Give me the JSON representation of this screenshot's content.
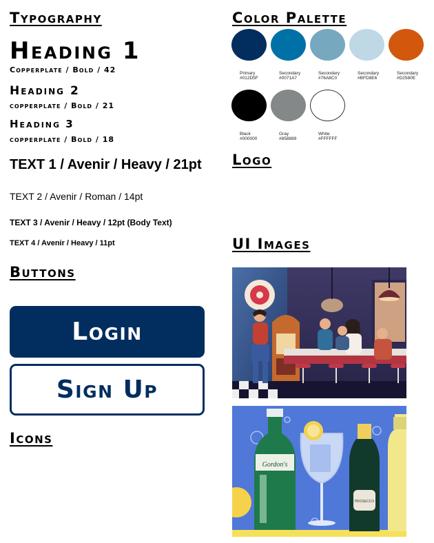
{
  "typography": {
    "title": "Typography",
    "heading1": {
      "text": "Heading 1",
      "spec": "Copperplate / Bold / 42"
    },
    "heading2": {
      "text": "Heading 2",
      "spec": "copperplate / Bold / 21"
    },
    "heading3": {
      "text": "Heading 3",
      "spec": "copperplate / Bold / 18"
    },
    "text1": "TEXT 1 / Avenir / Heavy / 21pt",
    "text2": "TEXT 2 / Avenir / Roman / 14pt",
    "text3": "TEXT 3 / Avenir / Heavy / 12pt (Body Text)",
    "text4": "TEXT 4 / Avenir / Heavy / 11pt"
  },
  "buttons": {
    "title": "Buttons",
    "login_label": "Login",
    "signup_label": "Sign Up"
  },
  "icons": {
    "title": "Icons"
  },
  "palette": {
    "title": "Color Palette",
    "row1": [
      {
        "name": "Primary",
        "hex": "#012D5F",
        "color": "#012D5F"
      },
      {
        "name": "Secondary",
        "hex": "#0071A7",
        "color": "#0071A7"
      },
      {
        "name": "Secondary",
        "hex": "#76A8C0",
        "color": "#76A8C0"
      },
      {
        "name": "Secondary",
        "hex": "#BFD8E6",
        "color": "#BFD8E6"
      },
      {
        "name": "Secondary",
        "hex": "#D2580E",
        "color": "#D2580E"
      }
    ],
    "row2": [
      {
        "name": "Black",
        "hex": "#000000",
        "color": "#000000"
      },
      {
        "name": "Gray",
        "hex": "#858889",
        "color": "#858889"
      },
      {
        "name": "White",
        "hex": "#FFFFFF",
        "color": "#FFFFFF"
      }
    ]
  },
  "logo": {
    "title": "Logo"
  },
  "ui_images": {
    "title": "UI Images",
    "bottle_label": "Gordon's",
    "prosecco_label": "PROSECCO"
  }
}
